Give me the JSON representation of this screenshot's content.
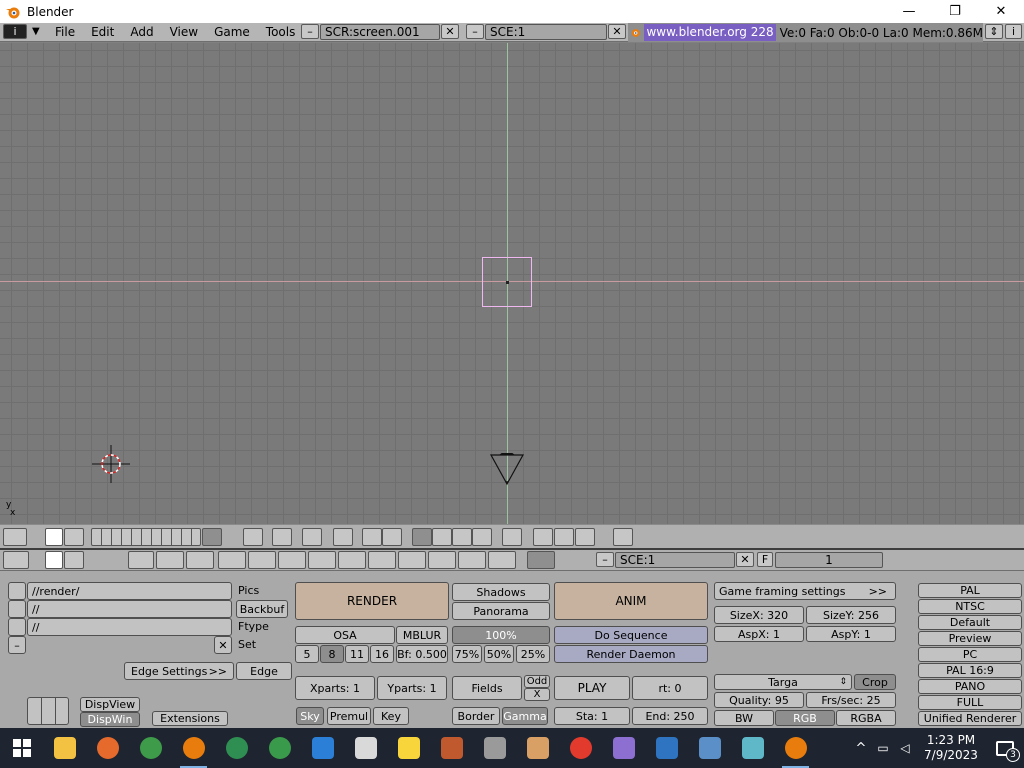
{
  "window": {
    "title": "Blender",
    "minimize": "—",
    "restore": "❐",
    "close": "✕"
  },
  "info_header": {
    "menus": [
      "File",
      "Edit",
      "Add",
      "View",
      "Game",
      "Tools"
    ],
    "screen_field": "SCR:screen.001",
    "scene_field": "SCE:1",
    "url": "www.blender.org 228",
    "stats": "Ve:0 Fa:0  Ob:0-0 La:0  Mem:0.86M"
  },
  "viewport": {
    "axis_label": "x"
  },
  "buttons_header": {
    "scene_field": "SCE:1",
    "frame_label": "F",
    "frame_value": "1"
  },
  "output": {
    "pics_path": "//render/",
    "pics_label": "Pics",
    "backbuf_path": "//",
    "backbuf_label": "Backbuf",
    "ftype_path": "//",
    "ftype_label": "Ftype",
    "set_label": "Set",
    "edge_settings": "Edge Settings",
    "edge_settings_arrow": ">>",
    "edge": "Edge",
    "dispview": "DispView",
    "dispwin": "DispWin",
    "extensions": "Extensions"
  },
  "render": {
    "render": "RENDER",
    "shadows": "Shadows",
    "panorama": "Panorama",
    "osa": "OSA",
    "mblur": "MBLUR",
    "percent": "100%",
    "osa_levels": [
      "5",
      "8",
      "11",
      "16"
    ],
    "bf": "Bf: 0.500",
    "sizes": [
      "75%",
      "50%",
      "25%"
    ],
    "xparts": "Xparts: 1",
    "yparts": "Yparts: 1",
    "fields": "Fields",
    "odd": "Odd",
    "x": "X",
    "sky": "Sky",
    "premul": "Premul",
    "key": "Key",
    "border": "Border",
    "gamma": "Gamma"
  },
  "anim": {
    "anim": "ANIM",
    "do_sequence": "Do Sequence",
    "render_daemon": "Render Daemon",
    "play": "PLAY",
    "rt": "rt: 0",
    "sta": "Sta: 1",
    "end": "End: 250"
  },
  "format": {
    "game_framing": "Game framing settings",
    "game_framing_arrow": ">>",
    "sizex": "SizeX: 320",
    "sizey": "SizeY: 256",
    "aspx": "AspX: 1",
    "aspy": "AspY: 1",
    "filetype": "Targa",
    "crop": "Crop",
    "quality": "Quality: 95",
    "frs": "Frs/sec: 25",
    "bw": "BW",
    "rgb": "RGB",
    "rgba": "RGBA"
  },
  "presets": [
    "PAL",
    "NTSC",
    "Default",
    "Preview",
    "PC",
    "PAL 16:9",
    "PANO",
    "FULL",
    "Unified Renderer"
  ],
  "taskbar": {
    "time": "1:23 PM",
    "date": "7/9/2023",
    "notifications": "3",
    "tasks": [
      {
        "name": "start-button",
        "color": "#ffffff"
      },
      {
        "name": "file-explorer-icon",
        "color": "#f3c243"
      },
      {
        "name": "firefox-icon",
        "color": "#e66a2c"
      },
      {
        "name": "chrome-icon",
        "color": "#3d9b4a"
      },
      {
        "name": "blender-icon",
        "color": "#e87d0d"
      },
      {
        "name": "chrome-user-icon",
        "color": "#2f8f53"
      },
      {
        "name": "chrome-profile-icon",
        "color": "#3a9a4b"
      },
      {
        "name": "calculator-icon",
        "color": "#2b7fd6"
      },
      {
        "name": "clock-app-icon",
        "color": "#d9d9d9"
      },
      {
        "name": "sticky-notes-icon",
        "color": "#f7d53b"
      },
      {
        "name": "game-app-icon",
        "color": "#c05a2e"
      },
      {
        "name": "usb-app-icon",
        "color": "#9a9a9a"
      },
      {
        "name": "package-app-icon",
        "color": "#d9a066"
      },
      {
        "name": "record-app-icon",
        "color": "#e23b2e"
      },
      {
        "name": "paint-app-icon",
        "color": "#8c6fd1"
      },
      {
        "name": "photos-app-icon",
        "color": "#2f74c0"
      },
      {
        "name": "camera-app-icon",
        "color": "#5a8fc7"
      },
      {
        "name": "notes-app-icon",
        "color": "#5fb8c8"
      },
      {
        "name": "blender-active-icon",
        "color": "#e87d0d"
      }
    ]
  }
}
